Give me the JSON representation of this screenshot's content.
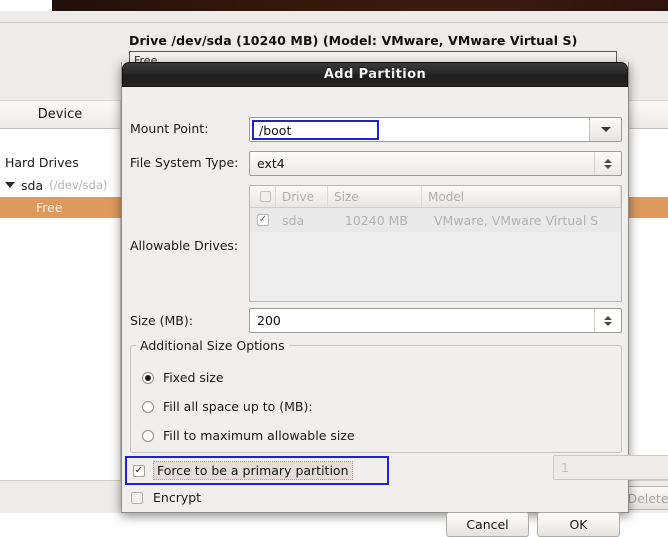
{
  "background": {
    "drive_title": "Drive /dev/sda (10240 MB) (Model: VMware, VMware Virtual S)",
    "drive_bar_label": "Free",
    "list_header": {
      "device_column": "Device"
    },
    "tree": [
      {
        "label": "Hard Drives",
        "device": "",
        "selected": false
      },
      {
        "label": "sda",
        "device": "/dev/sda",
        "selected": false
      },
      {
        "label": "Free",
        "device": "",
        "selected": true
      }
    ],
    "delete_button": "Delete",
    "selection_color": "#dd9a5e"
  },
  "dialog": {
    "title": "Add Partition",
    "mount_point": {
      "label": "Mount Point:",
      "value": "/boot",
      "placeholder": "",
      "focus_color": "#2222cc"
    },
    "file_system_type": {
      "label": "File System Type:",
      "value": "ext4"
    },
    "allowable_drives": {
      "label": "Allowable Drives:",
      "columns": [
        "",
        "Drive",
        "Size",
        "Model"
      ],
      "rows": [
        {
          "checked": "✓",
          "drive": "sda",
          "size": "10240 MB",
          "model": "VMware, VMware Virtual S"
        }
      ]
    },
    "size": {
      "label": "Size (MB):",
      "value": "200"
    },
    "additional_size_options": {
      "legend": "Additional Size Options",
      "options": [
        {
          "label": "Fixed size",
          "selected": true
        },
        {
          "label": "Fill all space up to (MB):",
          "selected": false
        },
        {
          "label": "Fill to maximum allowable size",
          "selected": false
        }
      ],
      "fill_up_to_value": "1"
    },
    "force_primary": {
      "label": "Force to be a primary partition",
      "checked": "✓"
    },
    "encrypt": {
      "label": "Encrypt",
      "checked": ""
    },
    "buttons": {
      "cancel": "Cancel",
      "ok": "OK"
    }
  }
}
